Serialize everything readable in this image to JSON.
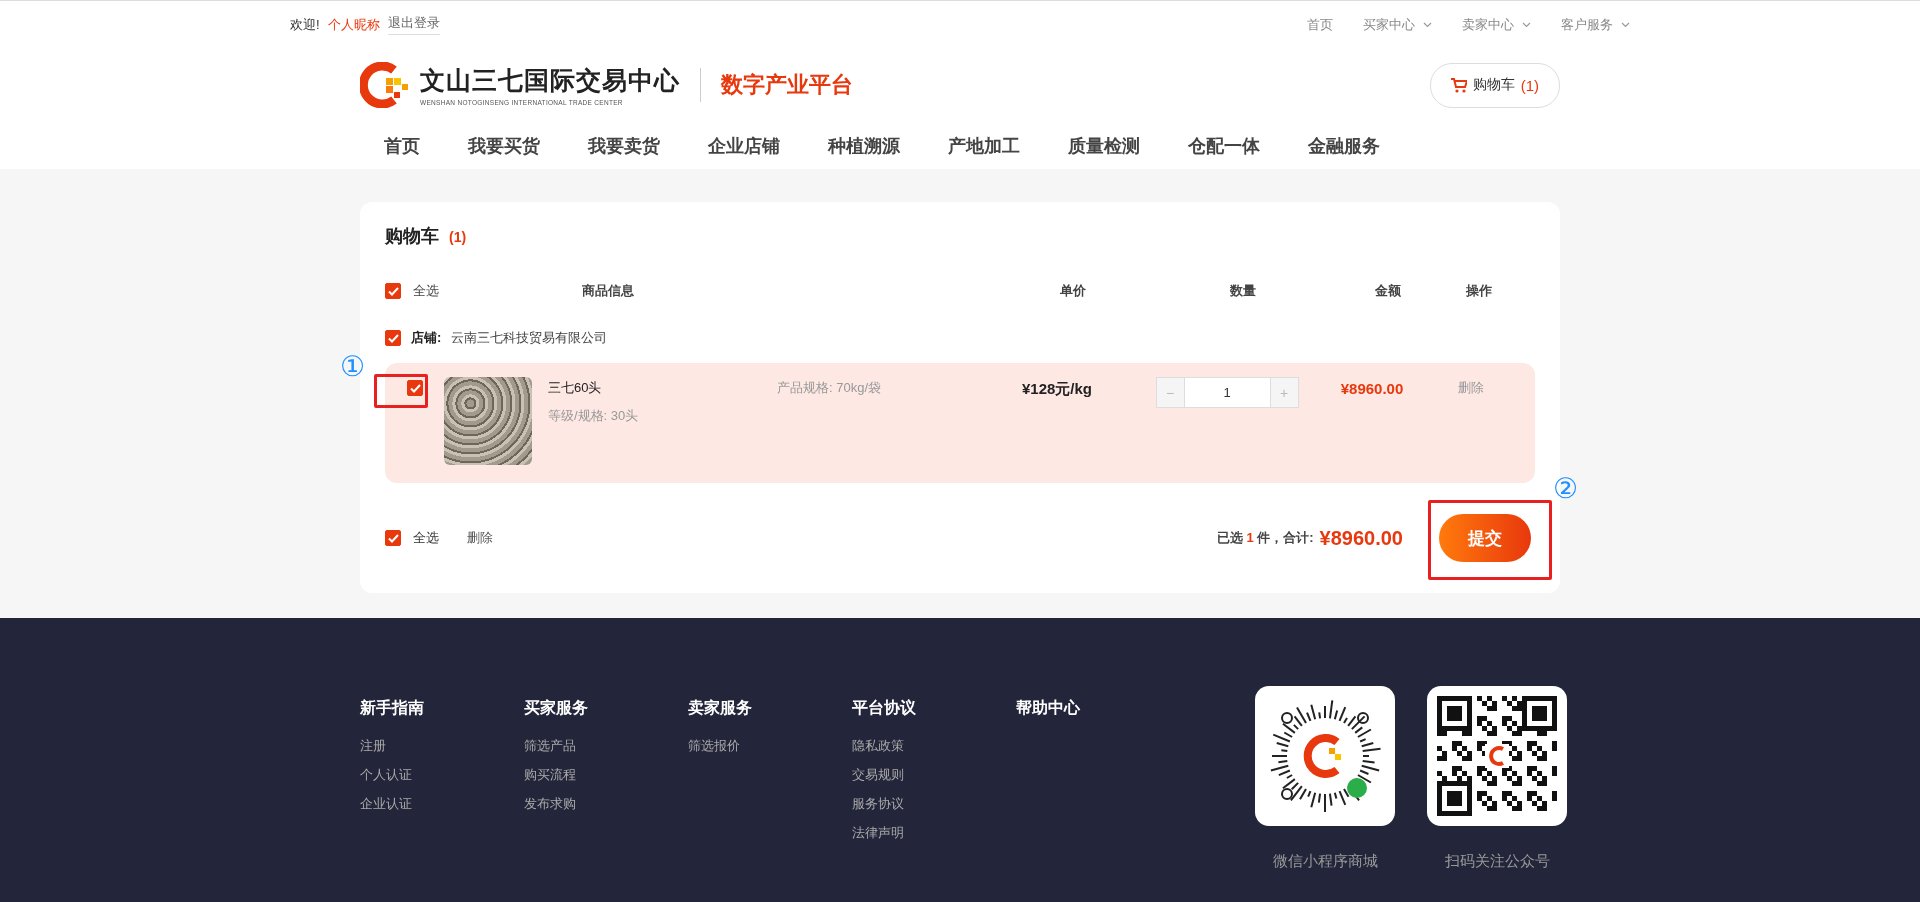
{
  "top_bar": {
    "welcome": "欢迎!",
    "nickname": "个人昵称",
    "logout": "退出登录",
    "links": [
      {
        "label": "首页",
        "has_menu": false
      },
      {
        "label": "买家中心",
        "has_menu": true
      },
      {
        "label": "卖家中心",
        "has_menu": true
      },
      {
        "label": "客户服务",
        "has_menu": true
      }
    ]
  },
  "header": {
    "logo_title": "文山三七国际交易中心",
    "logo_subtitle": "WENSHAN NOTOGINSENG INTERNATIONAL TRADE CENTER",
    "platform": "数字产业平台",
    "cart_label": "购物车",
    "cart_count": "(1)"
  },
  "nav": [
    "首页",
    "我要买货",
    "我要卖货",
    "企业店铺",
    "种植溯源",
    "产地加工",
    "质量检测",
    "仓配一体",
    "金融服务"
  ],
  "cart": {
    "title": "购物车",
    "count": "(1)",
    "columns": {
      "select_all": "全选",
      "select_all_checked": true,
      "info": "商品信息",
      "price": "单价",
      "quantity": "数量",
      "amount": "金额",
      "actions": "操作"
    },
    "shop": {
      "checked": true,
      "label": "店铺:",
      "name": "云南三七科技贸易有限公司"
    },
    "items": [
      {
        "checked": true,
        "name": "三七60头",
        "grade": "等级/规格:  30头",
        "spec": "产品规格:  70kg/袋",
        "price": "¥128元/kg",
        "minus": "−",
        "quantity": "1",
        "plus": "+",
        "amount": "¥8960.00",
        "delete": "删除"
      }
    ],
    "footer": {
      "select_all": "全选",
      "select_all_checked": true,
      "delete": "删除",
      "selected_prefix": "已选",
      "selected_count": "1",
      "selected_suffix": "件，合计:",
      "total": "¥8960.00",
      "submit": "提交"
    }
  },
  "annotations": [
    {
      "kind": "checkbox",
      "label": "①"
    },
    {
      "kind": "submit",
      "label": "②"
    }
  ],
  "footer": {
    "columns": [
      {
        "title": "新手指南",
        "links": [
          "注册",
          "个人认证",
          "企业认证"
        ]
      },
      {
        "title": "买家服务",
        "links": [
          "筛选产品",
          "购买流程",
          "发布求购"
        ]
      },
      {
        "title": "卖家服务",
        "links": [
          "筛选报价"
        ]
      },
      {
        "title": "平台协议",
        "links": [
          "隐私政策",
          "交易规则",
          "服务协议",
          "法律声明"
        ]
      },
      {
        "title": "帮助中心"
      }
    ],
    "codes": [
      {
        "kind": "mini_program",
        "caption": "微信小程序商城"
      },
      {
        "kind": "qr",
        "caption": "扫码关注公众号"
      }
    ]
  }
}
